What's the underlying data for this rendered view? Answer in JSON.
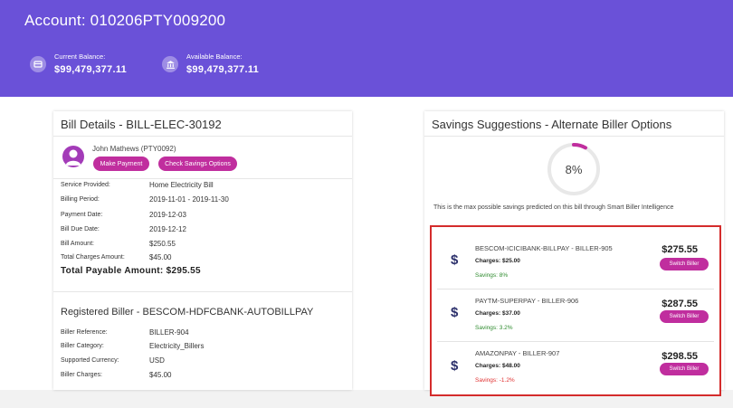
{
  "header": {
    "account_title": "Account: 010206PTY009200",
    "current_balance_label": "Current Balance:",
    "current_balance": "$99,479,377.11",
    "available_balance_label": "Available Balance:",
    "available_balance": "$99,479,377.11",
    "background_color": "#6a51d8"
  },
  "bill": {
    "title": "Bill Details - BILL-ELEC-30192",
    "user_name": "John Mathews (PTY0092)",
    "make_payment_label": "Make Payment",
    "check_savings_label": "Check Savings Options",
    "details": [
      {
        "label": "Service Provided:",
        "value": "Home Electricity Bill"
      },
      {
        "label": "Billing Period:",
        "value": "2019-11-01 - 2019-11-30"
      },
      {
        "label": "Payment Date:",
        "value": "2019-12-03"
      },
      {
        "label": "Bill Due Date:",
        "value": "2019-12-12"
      },
      {
        "label": "Bill Amount:",
        "value": "$250.55"
      },
      {
        "label": "Total Charges Amount:",
        "value": "$45.00"
      }
    ],
    "total_payable": "Total Payable Amount: $295.55"
  },
  "registered_biller": {
    "title": "Registered Biller - BESCOM-HDFCBANK-AUTOBILLPAY",
    "details": [
      {
        "label": "Biller Reference:",
        "value": "BILLER-904"
      },
      {
        "label": "Biller Category:",
        "value": "Electricity_Billers"
      },
      {
        "label": "Supported Currency:",
        "value": "USD"
      },
      {
        "label": "Biller Charges:",
        "value": "$45.00"
      }
    ]
  },
  "savings": {
    "title": "Savings Suggestions - Alternate Biller Options",
    "percent_text": "8%",
    "percent_value": 8,
    "description": "This is the max possible savings predicted on this bill through Smart Biller Intelligence",
    "switch_label": "Switch Biller",
    "options": [
      {
        "name": "BESCOM-ICICIBANK-BILLPAY - BILLER-905",
        "charges": "Charges: $25.00",
        "savings": "Savings: 8%",
        "price": "$275.55",
        "savings_color": "#2e8b2e"
      },
      {
        "name": "PAYTM-SUPERPAY - BILLER-906",
        "charges": "Charges: $37.00",
        "savings": "Savings: 3.2%",
        "price": "$287.55",
        "savings_color": "#2e8b2e"
      },
      {
        "name": "AMAZONPAY - BILLER-907",
        "charges": "Charges: $48.00",
        "savings": "Savings: -1.2%",
        "price": "$298.55",
        "savings_color": "#e03030"
      }
    ]
  },
  "colors": {
    "accent_button": "#c02e9e",
    "highlight_border": "#d42c2c"
  }
}
